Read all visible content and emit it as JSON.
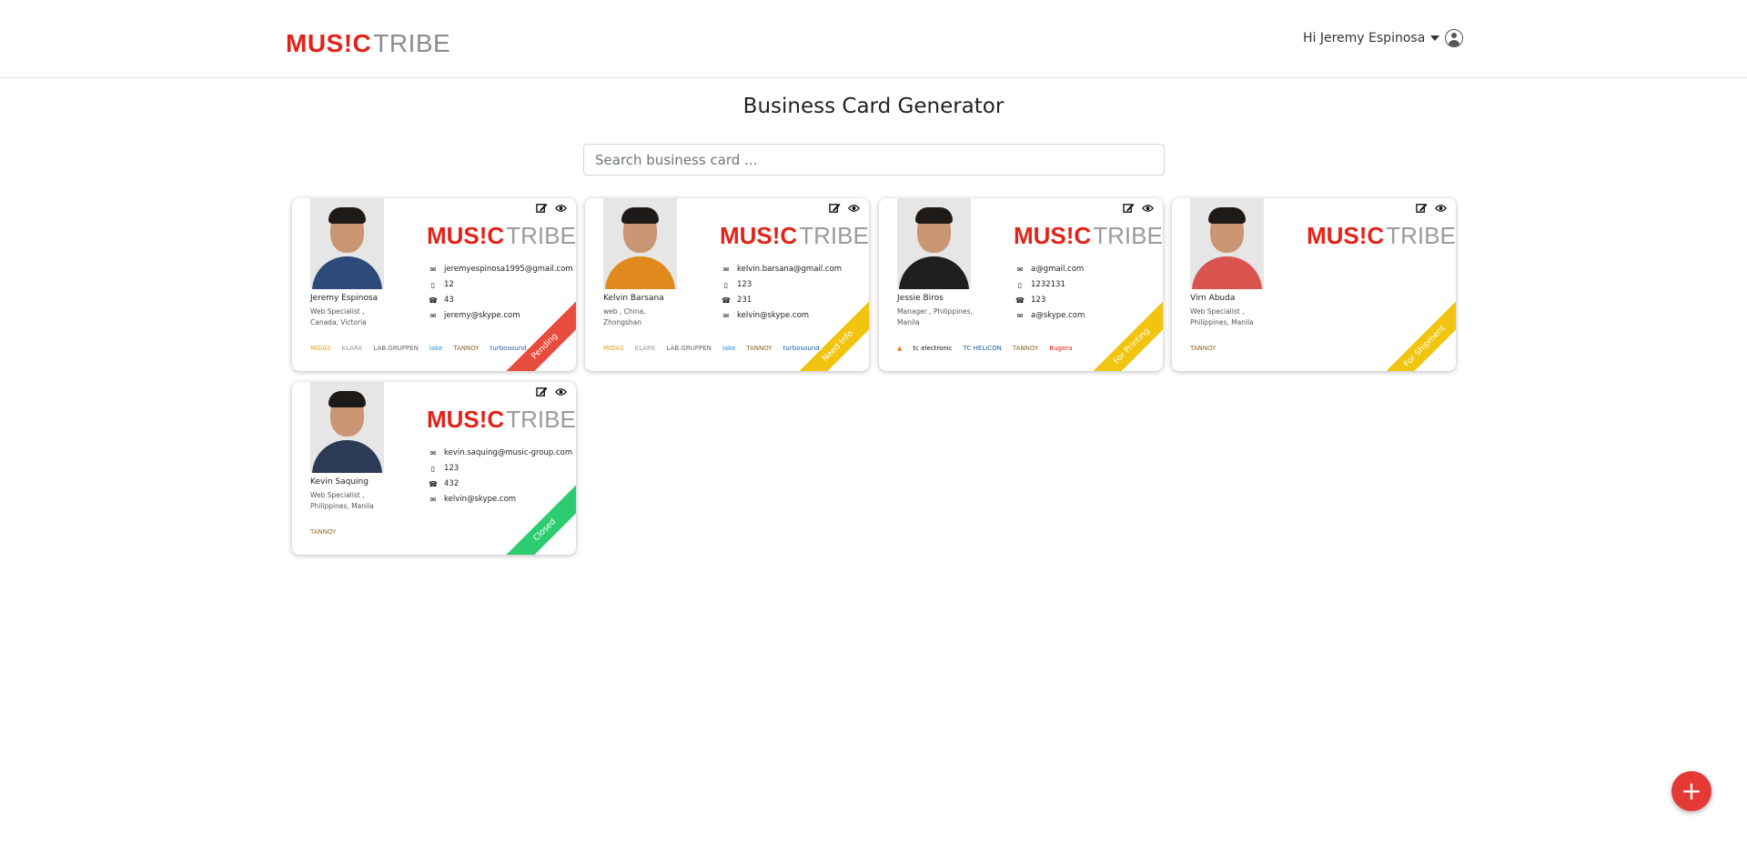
{
  "header": {
    "logo": {
      "part1": "MUS!C",
      "part2": "TRIBE"
    },
    "greeting": "Hi Jeremy Espinosa",
    "user_icon": "user-circle-icon"
  },
  "page": {
    "title": "Business Card Generator",
    "search_placeholder": "Search business card ..."
  },
  "cards": [
    {
      "name": "Jeremy Espinosa",
      "role_line1": "Web Specialist ,",
      "role_line2": "Canada, Victoria",
      "email": "jeremyespinosa1995@gmail.com",
      "mobile": "12",
      "phone": "43",
      "skype": "jeremy@skype.com",
      "brands": [
        "MIDAS",
        "KLARK",
        "LAB.GRUPPEN",
        "lake",
        "TANNOY",
        "turbosound"
      ],
      "status": "Pending",
      "status_color": "#e74c3c",
      "shirt_color": "#2c4a7a"
    },
    {
      "name": "Kelvin Barsana",
      "role_line1": "web , China,",
      "role_line2": "Zhongshan",
      "email": "kelvin.barsana@gmail.com",
      "mobile": "123",
      "phone": "231",
      "skype": "kelvin@skype.com",
      "brands": [
        "MIDAS",
        "KLARK",
        "LAB.GRUPPEN",
        "lake",
        "TANNOY",
        "turbosound"
      ],
      "status": "Need Info",
      "status_color": "#f1c40f",
      "shirt_color": "#e08a1e"
    },
    {
      "name": "Jessie Biros",
      "role_line1": "Manager , Philippines,",
      "role_line2": "Manila",
      "email": "a@gmail.com",
      "mobile": "1232131",
      "phone": "123",
      "skype": "a@skype.com",
      "brands": [
        "▲",
        "tc electronic",
        "TC HELICON",
        "TANNOY",
        "Bugera"
      ],
      "status": "For Printing",
      "status_color": "#f1c40f",
      "shirt_color": "#1f1f1f"
    },
    {
      "name": "Virn Abuda",
      "role_line1": "Web Specialist ,",
      "role_line2": "Philippines, Manila",
      "email": "",
      "mobile": "",
      "phone": "",
      "skype": "",
      "brands": [
        "TANNOY"
      ],
      "status": "For Shipment",
      "status_color": "#f1c40f",
      "shirt_color": "#d9534f"
    },
    {
      "name": "Kevin Saquing",
      "role_line1": "Web Specialist ,",
      "role_line2": "Philippines, Manila",
      "email": "kevin.saquing@music-group.com",
      "mobile": "123",
      "phone": "432",
      "skype": "kelvin@skype.com",
      "brands": [
        "TANNOY"
      ],
      "status": "Closed",
      "status_color": "#2ecc71",
      "shirt_color": "#2b3a55"
    }
  ],
  "fab": {
    "label": "+"
  }
}
